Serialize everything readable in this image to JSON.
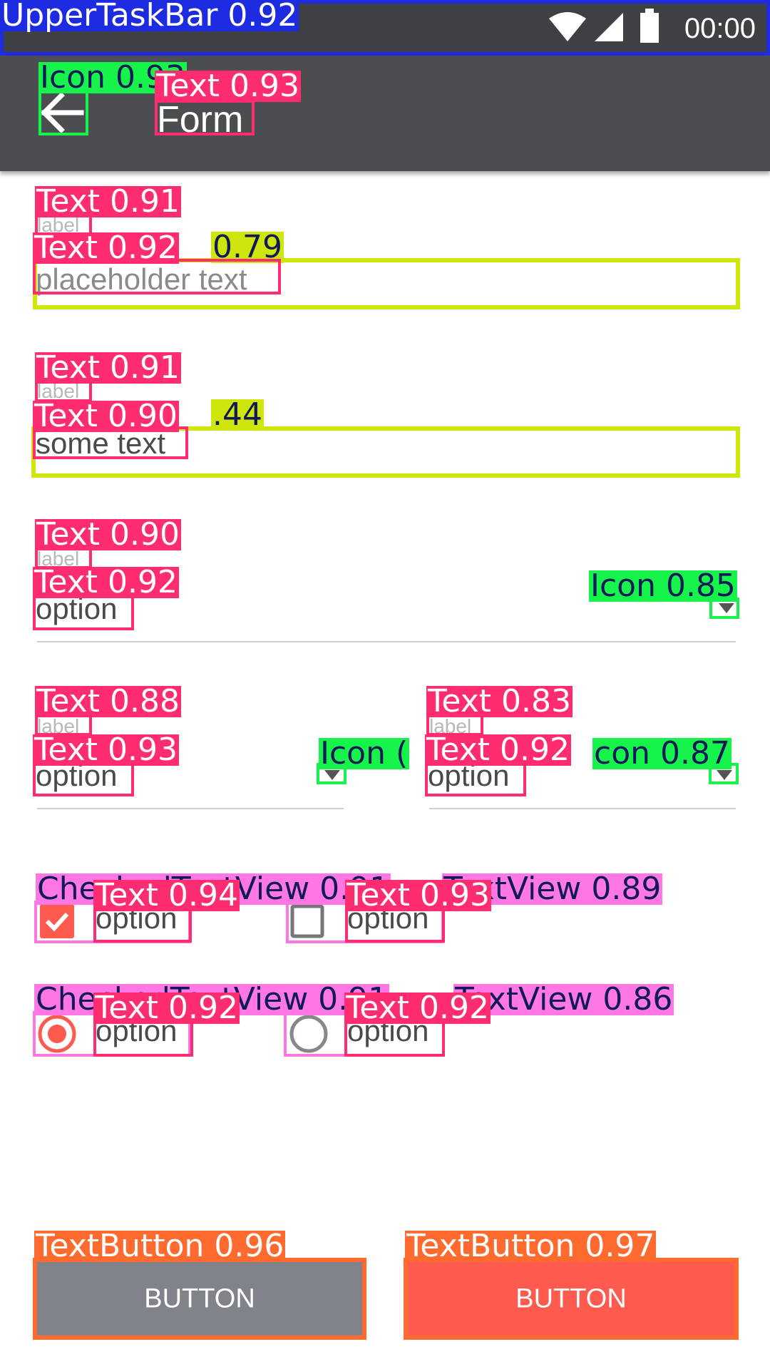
{
  "status_bar": {
    "time": "00:00"
  },
  "app_bar": {
    "title": "Form"
  },
  "fields": {
    "text_1": {
      "label": "label",
      "placeholder": "placeholder text"
    },
    "text_2": {
      "label": "label",
      "value": "some text"
    },
    "select_1": {
      "label": "label",
      "value": "option"
    },
    "select_2": {
      "label": "label",
      "value": "option"
    },
    "select_3": {
      "label": "label",
      "value": "option"
    }
  },
  "checkboxes": [
    {
      "label": "option",
      "checked": true
    },
    {
      "label": "option",
      "checked": false
    }
  ],
  "radios": [
    {
      "label": "option",
      "selected": true
    },
    {
      "label": "option",
      "selected": false
    }
  ],
  "buttons": [
    {
      "label": "BUTTON",
      "style": "gray"
    },
    {
      "label": "BUTTON",
      "style": "red"
    }
  ],
  "overlay": {
    "upper_taskbar": "UpperTaskBar 0.92",
    "icon_back": "Icon 0.93",
    "text_title": "Text 0.93",
    "text_label_1": "Text 0.91",
    "text_input_1": "Text 0.92",
    "input_1": "0.79",
    "text_label_2": "Text 0.91",
    "text_input_2": "Text 0.90",
    "input_2": ".44",
    "text_label_3": "Text 0.90",
    "text_select_3": "Text 0.92",
    "icon_dd_3": "Icon 0.85",
    "text_label_4": "Text 0.88",
    "text_select_4": "Text 0.93",
    "icon_dd_4": "Icon (",
    "text_label_5": "Text 0.83",
    "text_select_5": "Text 0.92",
    "icon_dd_5": "con 0.87",
    "ctv_1": "CheckedTextView 0.91",
    "ctv_2": "TextView 0.89",
    "text_cb_1": "Text 0.94",
    "text_cb_2": "Text 0.93",
    "ctv_3": "CheckedTextView 0.91",
    "ctv_4": "TextView 0.86",
    "text_rb_1": "Text 0.92",
    "text_rb_2": "Text 0.92",
    "btn_1": "TextButton 0.96",
    "btn_2": "TextButton 0.97"
  },
  "colors": {
    "status_bar": "#3e4044",
    "app_bar": "#4b4d51",
    "accent": "#ff5a4e",
    "button_gray": "#80848a"
  }
}
